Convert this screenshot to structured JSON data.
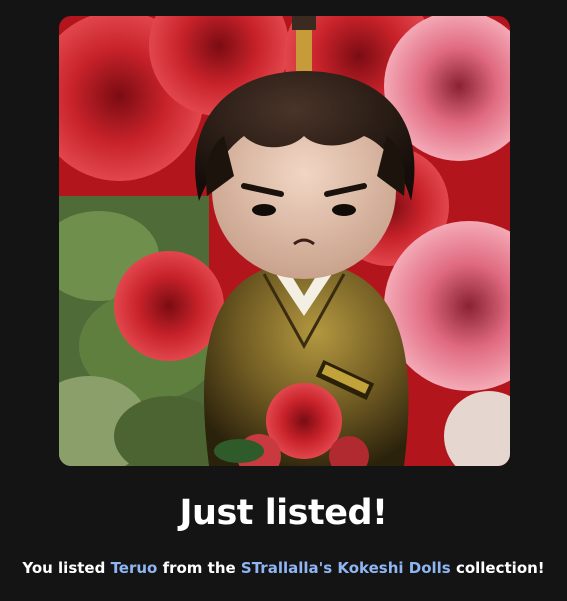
{
  "dialog": {
    "title": "Just listed!",
    "message": {
      "prefix": "You listed ",
      "item_name": "Teruo",
      "middle": " from the ",
      "collection_name": "STrallalla's Kokeshi Dolls",
      "suffix": " collection!"
    }
  },
  "colors": {
    "background": "#141414",
    "text": "#ffffff",
    "link": "#8fb6f2"
  },
  "image": {
    "icon": "kokeshi-doll-artwork"
  }
}
